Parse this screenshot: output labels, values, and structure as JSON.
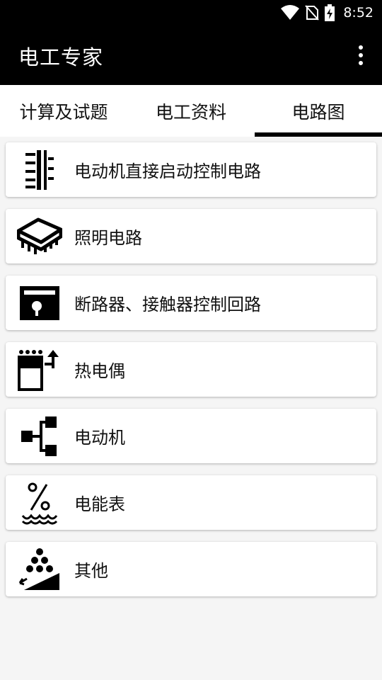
{
  "status_bar": {
    "time": "8:52"
  },
  "app_bar": {
    "title": "电工专家"
  },
  "tabs": [
    {
      "label": "计算及试题"
    },
    {
      "label": "电工资料"
    },
    {
      "label": "电路图",
      "active": true
    }
  ],
  "items": [
    {
      "label": "电动机直接启动控制电路",
      "icon": "circuit-lines-icon"
    },
    {
      "label": "照明电路",
      "icon": "chip-icon"
    },
    {
      "label": "断路器、接触器控制回路",
      "icon": "breaker-icon"
    },
    {
      "label": "热电偶",
      "icon": "thermocouple-icon"
    },
    {
      "label": "电动机",
      "icon": "network-tree-icon"
    },
    {
      "label": "电能表",
      "icon": "percent-wave-icon"
    },
    {
      "label": "其他",
      "icon": "balls-slope-icon"
    }
  ],
  "colors": {
    "appbar": "#000000",
    "background": "#f5f5f5",
    "card": "#ffffff",
    "tab_indicator": "#000000"
  }
}
